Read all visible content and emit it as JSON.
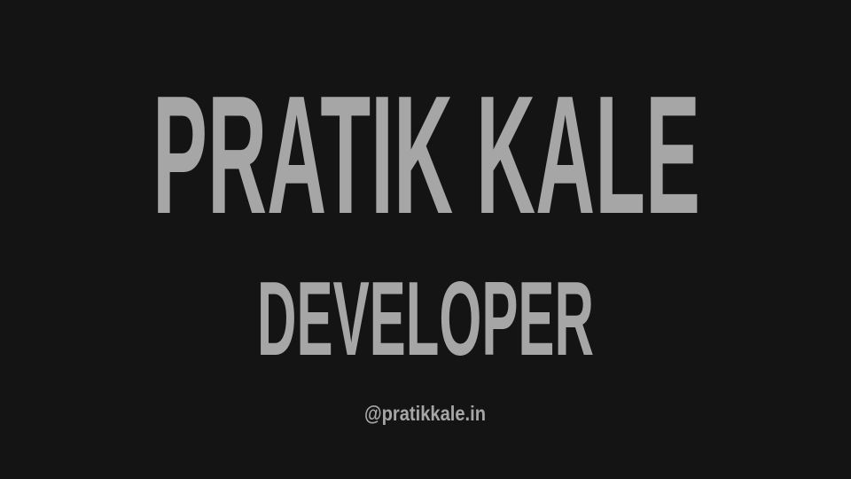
{
  "name": "PRATIK KALE",
  "role": "DEVELOPER",
  "handle": "@pratikkale.in",
  "colors": {
    "background": "#141414",
    "text": "#a6a6a6"
  }
}
